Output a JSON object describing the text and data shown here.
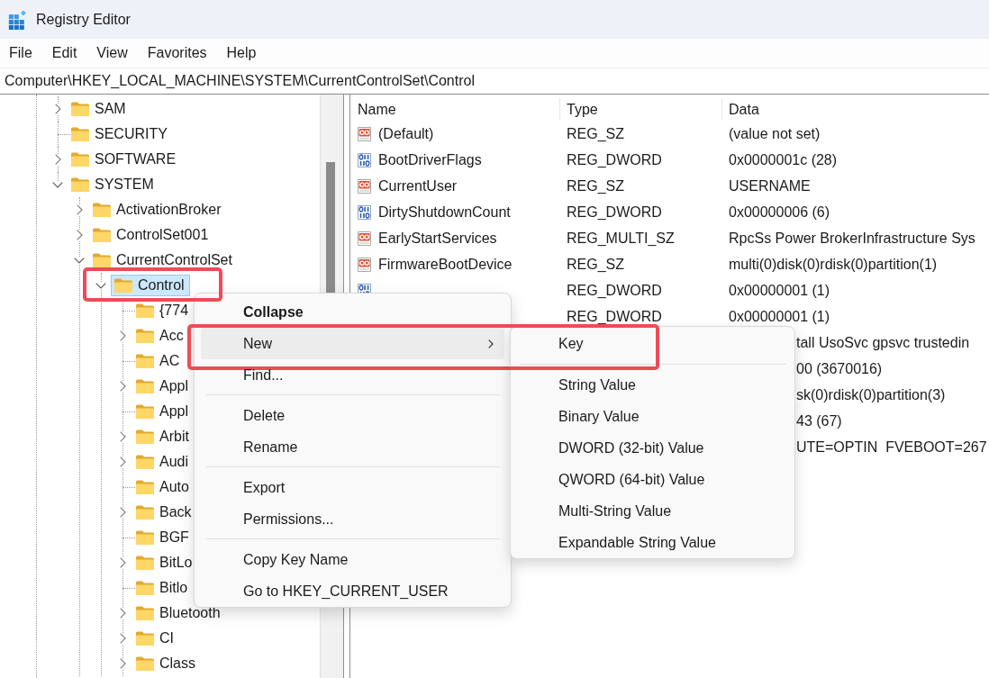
{
  "window": {
    "title": "Registry Editor"
  },
  "menu_bar": [
    "File",
    "Edit",
    "View",
    "Favorites",
    "Help"
  ],
  "address_bar": {
    "value": "Computer\\HKEY_LOCAL_MACHINE\\SYSTEM\\CurrentControlSet\\Control"
  },
  "tree": {
    "items": [
      {
        "label": "SAM",
        "kind": "branch",
        "expanded": false,
        "selected": false,
        "highlighted": false
      },
      {
        "label": "SECURITY",
        "kind": "leaf",
        "selected": false,
        "highlighted": false
      },
      {
        "label": "SOFTWARE",
        "kind": "branch",
        "expanded": false,
        "selected": false,
        "highlighted": false
      },
      {
        "label": "SYSTEM",
        "kind": "branch",
        "expanded": true,
        "selected": false,
        "highlighted": false,
        "children": [
          {
            "label": "ActivationBroker",
            "kind": "branch",
            "expanded": false,
            "selected": false,
            "highlighted": false
          },
          {
            "label": "ControlSet001",
            "kind": "branch",
            "expanded": false,
            "selected": false,
            "highlighted": false
          },
          {
            "label": "CurrentControlSet",
            "kind": "branch",
            "expanded": true,
            "selected": false,
            "highlighted": false,
            "children": [
              {
                "label": "Control",
                "kind": "branch",
                "expanded": true,
                "selected": true,
                "highlighted": true,
                "children": [
                  {
                    "label": "{774",
                    "kind": "leaf",
                    "selected": false,
                    "highlighted": false
                  },
                  {
                    "label": "Acc",
                    "kind": "branch",
                    "expanded": false,
                    "selected": false,
                    "highlighted": false
                  },
                  {
                    "label": "AC",
                    "kind": "leaf",
                    "selected": false,
                    "highlighted": false
                  },
                  {
                    "label": "Appl",
                    "kind": "branch",
                    "expanded": false,
                    "selected": false,
                    "highlighted": false
                  },
                  {
                    "label": "Appl",
                    "kind": "leaf",
                    "selected": false,
                    "highlighted": false
                  },
                  {
                    "label": "Arbit",
                    "kind": "branch",
                    "expanded": false,
                    "selected": false,
                    "highlighted": false
                  },
                  {
                    "label": "Audi",
                    "kind": "branch",
                    "expanded": false,
                    "selected": false,
                    "highlighted": false
                  },
                  {
                    "label": "Auto",
                    "kind": "leaf",
                    "selected": false,
                    "highlighted": false
                  },
                  {
                    "label": "Back",
                    "kind": "branch",
                    "expanded": false,
                    "selected": false,
                    "highlighted": false
                  },
                  {
                    "label": "BGF",
                    "kind": "leaf",
                    "selected": false,
                    "highlighted": false
                  },
                  {
                    "label": "BitLo",
                    "kind": "branch",
                    "expanded": false,
                    "selected": false,
                    "highlighted": false
                  },
                  {
                    "label": "Bitlo",
                    "kind": "leaf",
                    "selected": false,
                    "highlighted": false
                  },
                  {
                    "label": "Bluetooth",
                    "kind": "branch",
                    "expanded": false,
                    "selected": false,
                    "highlighted": false
                  },
                  {
                    "label": "CI",
                    "kind": "branch",
                    "expanded": false,
                    "selected": false,
                    "highlighted": false
                  },
                  {
                    "label": "Class",
                    "kind": "branch",
                    "expanded": false,
                    "selected": false,
                    "highlighted": false
                  }
                ]
              }
            ]
          }
        ]
      }
    ]
  },
  "values": {
    "columns": [
      "Name",
      "Type",
      "Data"
    ],
    "rows": [
      {
        "kind": "string",
        "name": "(Default)",
        "type": "REG_SZ",
        "data": "(value not set)"
      },
      {
        "kind": "binary",
        "name": "BootDriverFlags",
        "type": "REG_DWORD",
        "data": "0x0000001c (28)"
      },
      {
        "kind": "string",
        "name": "CurrentUser",
        "type": "REG_SZ",
        "data": "USERNAME"
      },
      {
        "kind": "binary",
        "name": "DirtyShutdownCount",
        "type": "REG_DWORD",
        "data": "0x00000006 (6)"
      },
      {
        "kind": "string",
        "name": "EarlyStartServices",
        "type": "REG_MULTI_SZ",
        "data": "RpcSs Power BrokerInfrastructure Sys"
      },
      {
        "kind": "string",
        "name": "FirmwareBootDevice",
        "type": "REG_SZ",
        "data": "multi(0)disk(0)rdisk(0)partition(1)"
      },
      {
        "kind": "binary",
        "type": "REG_DWORD",
        "data": "0x00000001 (1)"
      },
      {
        "kind": "plain",
        "type": "REG_DWORD",
        "data": "0x00000001 (1)"
      },
      {
        "kind": "covered",
        "data": "tall UsoSvc gpsvc trustedin"
      },
      {
        "kind": "covered",
        "data": "00 (3670016)"
      },
      {
        "kind": "covered",
        "data": "sk(0)rdisk(0)partition(3)"
      },
      {
        "kind": "covered",
        "data": "43 (67)"
      },
      {
        "kind": "covered",
        "data": "UTE=OPTIN  FVEBOOT=267"
      }
    ]
  },
  "context_menu": {
    "items": [
      {
        "kind": "item",
        "label": "Collapse",
        "default": true,
        "highlighted": false
      },
      {
        "kind": "submenu",
        "label": "New",
        "default": false,
        "expanded": true,
        "highlighted": true,
        "children": [
          {
            "kind": "item",
            "label": "Key",
            "highlighted": true
          },
          {
            "kind": "separator"
          },
          {
            "kind": "item",
            "label": "String Value",
            "highlighted": false
          },
          {
            "kind": "item",
            "label": "Binary Value",
            "highlighted": false
          },
          {
            "kind": "item",
            "label": "DWORD (32-bit) Value",
            "highlighted": false
          },
          {
            "kind": "item",
            "label": "QWORD (64-bit) Value",
            "highlighted": false
          },
          {
            "kind": "item",
            "label": "Multi-String Value",
            "highlighted": false
          },
          {
            "kind": "item",
            "label": "Expandable String Value",
            "highlighted": false
          }
        ]
      },
      {
        "kind": "item",
        "label": "Find...",
        "default": false,
        "highlighted": false
      },
      {
        "kind": "separator"
      },
      {
        "kind": "item",
        "label": "Delete",
        "default": false,
        "highlighted": false
      },
      {
        "kind": "item",
        "label": "Rename",
        "default": false,
        "highlighted": false
      },
      {
        "kind": "separator"
      },
      {
        "kind": "item",
        "label": "Export",
        "default": false,
        "highlighted": false
      },
      {
        "kind": "item",
        "label": "Permissions...",
        "default": false,
        "highlighted": false
      },
      {
        "kind": "separator"
      },
      {
        "kind": "item",
        "label": "Copy Key Name",
        "default": false,
        "highlighted": false
      },
      {
        "kind": "item",
        "label": "Go to HKEY_CURRENT_USER",
        "default": false,
        "highlighted": false
      }
    ]
  }
}
